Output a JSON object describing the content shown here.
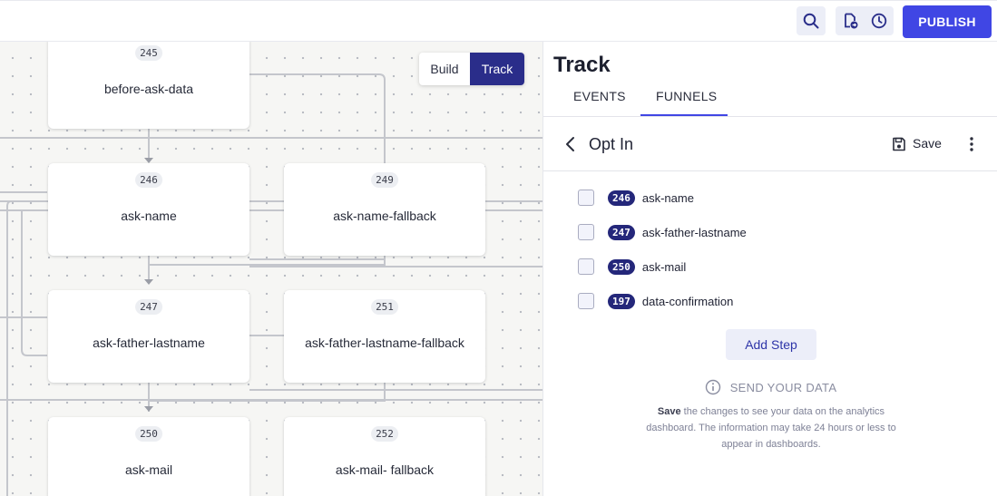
{
  "topbar": {
    "search_icon": "search-icon",
    "save_version_icon": "file-export-icon",
    "history_icon": "clock-icon",
    "publish_label": "PUBLISH",
    "accent": "#4046e4"
  },
  "canvas": {
    "mode_toggle": {
      "build_label": "Build",
      "track_label": "Track",
      "active": "Track"
    },
    "nodes": [
      {
        "id": "245",
        "label": "before-ask-data"
      },
      {
        "id": "246",
        "label": "ask-name"
      },
      {
        "id": "249",
        "label": "ask-name-fallback"
      },
      {
        "id": "247",
        "label": "ask-father-lastname"
      },
      {
        "id": "251",
        "label": "ask-father-lastname-fallback"
      },
      {
        "id": "250",
        "label": "ask-mail"
      },
      {
        "id": "252",
        "label": "ask-mail- fallback"
      }
    ]
  },
  "panel": {
    "title": "Track",
    "tabs": [
      {
        "label": "EVENTS"
      },
      {
        "label": "FUNNELS",
        "active": true
      }
    ],
    "funnel": {
      "name": "Opt In",
      "save_label": "Save",
      "steps": [
        {
          "id": "246",
          "name": "ask-name",
          "checked": false
        },
        {
          "id": "247",
          "name": "ask-father-lastname",
          "checked": false
        },
        {
          "id": "250",
          "name": "ask-mail",
          "checked": false
        },
        {
          "id": "197",
          "name": "data-confirmation",
          "checked": false
        }
      ],
      "add_step_label": "Add Step",
      "send_data_title": "SEND YOUR DATA",
      "help_bold": "Save",
      "help_text": " the changes to see your data on the analytics dashboard. The information may take 24 hours or less to appear in dashboards."
    }
  }
}
